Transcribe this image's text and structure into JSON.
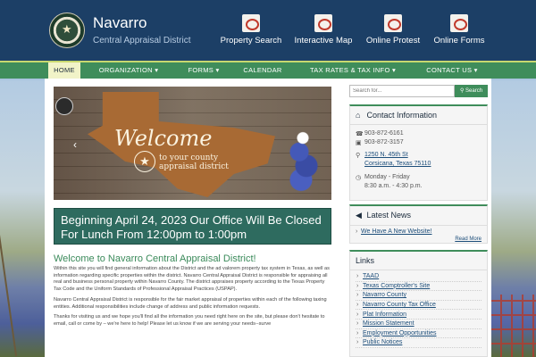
{
  "header": {
    "site_name": "Navarro",
    "site_sub": "Central Appraisal District",
    "quick_links": [
      {
        "label": "Property Search",
        "icon": "magnifier-icon"
      },
      {
        "label": "Interactive Map",
        "icon": "map-icon"
      },
      {
        "label": "Online Protest",
        "icon": "protest-icon"
      },
      {
        "label": "Online Forms",
        "icon": "forms-icon"
      }
    ]
  },
  "nav": {
    "items": [
      "HOME",
      "ORGANIZATION ▾",
      "FORMS ▾",
      "CALENDAR",
      "TAX RATES & TAX INFO ▾",
      "CONTACT US ▾"
    ]
  },
  "slider": {
    "welcome": "Welcome",
    "sub": "to your county appraisal district"
  },
  "announcement": "Beginning April 24, 2023 Our Office Will Be Closed For Lunch From 12:00pm to 1:00pm",
  "main": {
    "heading": "Welcome to Navarro Central Appraisal District!",
    "paragraphs": [
      "Within this site you will find general information about the District and the ad valorem property tax system in Texas, as well as information regarding specific properties within the district. Navarro Central Appraisal District is responsible for appraising all real and business personal property within Navarro County. The district appraises property according to the Texas Property Tax Code and the Uniform Standards of Professional Appraisal Practices (USPAP).",
      "Navarro Central Appraisal District is responsible for the fair market appraisal of properties within each of the following taxing entities. Additional responsibilities include change of address and public information requests.",
      "Thanks for visiting us and we hope you'll find all the information you need right here on the site, but please don't hesitate to email, call or come by – we're here to help!  Please let us know if we are serving your needs--surve"
    ]
  },
  "search": {
    "placeholder": "Search for...",
    "button": "Search"
  },
  "contact": {
    "title": "Contact Information",
    "phone": "903-872-6161",
    "fax": "903-872-3157",
    "address1": "1250 N. 45th St",
    "address2": "Corsicana, Texas 75110",
    "hours1": "Monday - Friday",
    "hours2": "8:30 a.m. - 4:30 p.m."
  },
  "news": {
    "title": "Latest News",
    "items": [
      "We Have A New Website!"
    ],
    "read_more": "Read More"
  },
  "links": {
    "title": "Links",
    "items": [
      "TAAD",
      "Texas Comptroller's Site",
      "Navarro County",
      "Navarro County Tax Office",
      "Plat Information",
      "Mission Statement",
      "Employment Opportunities",
      "Public Notices"
    ]
  },
  "colors": {
    "header": "#1c3f66",
    "nav": "#3f8d5b",
    "accent_green": "#3a8a5a",
    "announce": "#2e6b5f"
  }
}
